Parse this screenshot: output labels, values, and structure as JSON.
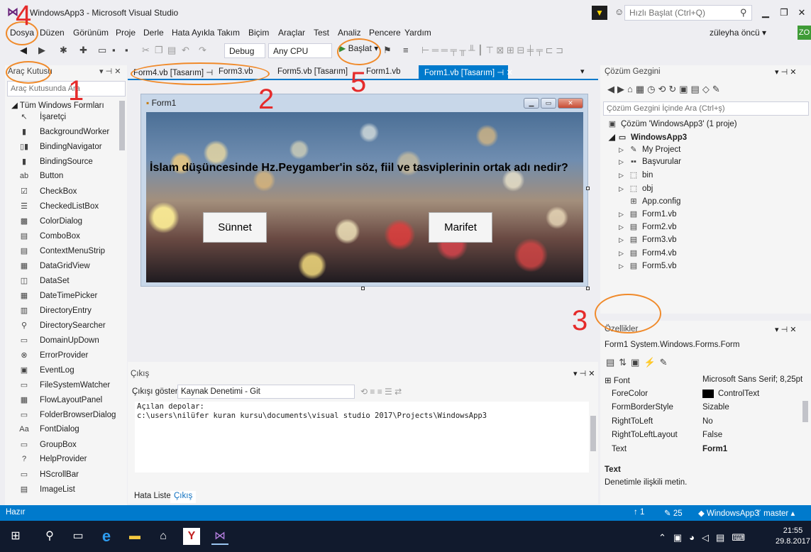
{
  "window": {
    "title": "WindowsApp3 - Microsoft Visual Studio",
    "quick_launch_placeholder": "Hızlı Başlat (Ctrl+Q)",
    "user_name": "züleyha öncü ▾",
    "user_initials": "ZO"
  },
  "menu": [
    "Dosya",
    "Düzen",
    "Görünüm",
    "Proje",
    "Derle",
    "Hata Ayıkla",
    "Takım",
    "Biçim",
    "Araçlar",
    "Test",
    "Analiz",
    "Pencere",
    "Yardım"
  ],
  "toolbar": {
    "config": "Debug",
    "platform": "Any CPU",
    "start_label": "Başlat ▾"
  },
  "annotations": {
    "n1": "1",
    "n2": "2",
    "n3": "3",
    "n4": "4",
    "n5": "5",
    "accent_color": "#e52b2b",
    "circle_color": "#f08a2a"
  },
  "toolbox": {
    "title": "Araç Kutusu",
    "search_placeholder": "Araç Kutusunda Ara",
    "section": "◢ Tüm Windows Formları",
    "items": [
      {
        "label": "İşaretçi",
        "icon": "pointer-icon"
      },
      {
        "label": "BackgroundWorker",
        "icon": "backgroundworker-icon"
      },
      {
        "label": "BindingNavigator",
        "icon": "bindingnavigator-icon"
      },
      {
        "label": "BindingSource",
        "icon": "bindingsource-icon"
      },
      {
        "label": "Button",
        "icon": "button-icon"
      },
      {
        "label": "CheckBox",
        "icon": "checkbox-icon"
      },
      {
        "label": "CheckedListBox",
        "icon": "checkedlistbox-icon"
      },
      {
        "label": "ColorDialog",
        "icon": "colordialog-icon"
      },
      {
        "label": "ComboBox",
        "icon": "combobox-icon"
      },
      {
        "label": "ContextMenuStrip",
        "icon": "contextmenustrip-icon"
      },
      {
        "label": "DataGridView",
        "icon": "datagridview-icon"
      },
      {
        "label": "DataSet",
        "icon": "dataset-icon"
      },
      {
        "label": "DateTimePicker",
        "icon": "datetimepicker-icon"
      },
      {
        "label": "DirectoryEntry",
        "icon": "directoryentry-icon"
      },
      {
        "label": "DirectorySearcher",
        "icon": "directorysearcher-icon"
      },
      {
        "label": "DomainUpDown",
        "icon": "domainupdown-icon"
      },
      {
        "label": "ErrorProvider",
        "icon": "errorprovider-icon"
      },
      {
        "label": "EventLog",
        "icon": "eventlog-icon"
      },
      {
        "label": "FileSystemWatcher",
        "icon": "filesystemwatcher-icon"
      },
      {
        "label": "FlowLayoutPanel",
        "icon": "flowlayoutpanel-icon"
      },
      {
        "label": "FolderBrowserDialog",
        "icon": "folderbrowserdialog-icon"
      },
      {
        "label": "FontDialog",
        "icon": "fontdialog-icon"
      },
      {
        "label": "GroupBox",
        "icon": "groupbox-icon"
      },
      {
        "label": "HelpProvider",
        "icon": "helpprovider-icon"
      },
      {
        "label": "HScrollBar",
        "icon": "hscrollbar-icon"
      },
      {
        "label": "ImageList",
        "icon": "imagelist-icon"
      }
    ]
  },
  "tabs": [
    "Form4.vb [Tasarım]",
    "Form3.vb",
    "Form5.vb [Tasarım]",
    "Form1.vb",
    "Form1.vb [Tasarım]"
  ],
  "form": {
    "caption": "Form1",
    "question": "İslam düşüncesinde Hz.Peygamber'in söz, fiil ve tasviplerinin ortak adı nedir?",
    "button1": "Sünnet",
    "button2": "Marifet"
  },
  "output": {
    "title": "Çıkış",
    "source_label": "Çıkışı göster:",
    "source_value": "Kaynak Denetimi - Git",
    "lines": [
      "Açılan depolar:",
      "c:\\users\\nilüfer kuran kursu\\documents\\visual studio 2017\\Projects\\WindowsApp3"
    ],
    "bottom_tabs": [
      "Hata Listesi",
      "Çıkış"
    ]
  },
  "solution": {
    "title": "Çözüm Gezgini",
    "search_placeholder": "Çözüm Gezgini İçinde Ara (Ctrl+ş)",
    "root": "Çözüm 'WindowsApp3' (1 proje)",
    "project": "WindowsApp3",
    "items": [
      "My Project",
      "Başvurular",
      "bin",
      "obj",
      "App.config",
      "Form1.vb",
      "Form2.vb",
      "Form3.vb",
      "Form4.vb",
      "Form5.vb"
    ]
  },
  "properties": {
    "title": "Özellikler",
    "object": "Form1 System.Windows.Forms.Form",
    "rows": [
      {
        "name": "⊞ Font",
        "value": "Microsoft Sans Serif; 8,25pt"
      },
      {
        "name": "ForeColor",
        "value": "ControlText"
      },
      {
        "name": "FormBorderStyle",
        "value": "Sizable"
      },
      {
        "name": "RightToLeft",
        "value": "No"
      },
      {
        "name": "RightToLeftLayout",
        "value": "False"
      },
      {
        "name": "Text",
        "value": "Form1"
      }
    ],
    "desc_title": "Text",
    "desc": "Denetimle ilişkili metin."
  },
  "statusbar": {
    "left": "Hazır",
    "arrows": "↑ 1",
    "edits": "✎ 25",
    "project": "WindowsApp3",
    "branch": "master ▴"
  },
  "taskbar": {
    "time": "21:55",
    "date": "29.8.2017"
  }
}
